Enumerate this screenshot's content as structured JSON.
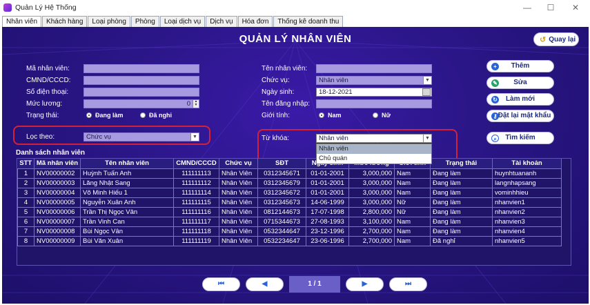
{
  "window": {
    "title": "Quản Lý Hệ Thống",
    "minimize": "—",
    "maximize": "☐",
    "close": "✕"
  },
  "tabs": [
    "Nhân viên",
    "Khách hàng",
    "Loại phòng",
    "Phòng",
    "Loại dịch vụ",
    "Dịch vụ",
    "Hóa đơn",
    "Thống kê doanh thu"
  ],
  "page": {
    "title": "QUẢN LÝ NHÂN VIÊN",
    "back_label": "Quay lại",
    "back_icon": "↺"
  },
  "form": {
    "ma_nhan_vien_label": "Mã nhân viên:",
    "cmnd_label": "CMND/CCCD:",
    "sdt_label": "Số điện thoại:",
    "muc_luong_label": "Mức lương:",
    "muc_luong_value": "0",
    "trang_thai_label": "Trạng thái:",
    "trang_thai_opt1": "Đang làm",
    "trang_thai_opt2": "Đã nghỉ",
    "ten_nv_label": "Tên nhân viên:",
    "chuc_vu_label": "Chức vụ:",
    "chuc_vu_value": "Nhân viên",
    "ngay_sinh_label": "Ngày sinh:",
    "ngay_sinh_value": "18-12-2021",
    "ten_dang_nhap_label": "Tên đăng nhập:",
    "gioi_tinh_label": "Giới tính:",
    "gioi_tinh_opt1": "Nam",
    "gioi_tinh_opt2": "Nữ"
  },
  "filter": {
    "loc_theo_label": "Lọc theo:",
    "loc_theo_value": "Chức vụ",
    "tu_khoa_label": "Từ khóa:",
    "tu_khoa_value": "Nhân viên",
    "options": [
      "Nhân viên",
      "Chủ quán"
    ]
  },
  "actions": {
    "them": "Thêm",
    "sua": "Sửa",
    "lam_moi": "Làm mới",
    "dat_lai_mk": "Đặt lại mật khẩu",
    "tim_kiem": "Tìm kiếm"
  },
  "table": {
    "title": "Danh sách nhân viên",
    "columns": [
      "STT",
      "Mã nhân viên",
      "Tên nhân viên",
      "CMND/CCCD",
      "Chức vụ",
      "SĐT",
      "Ngày sinh",
      "Mức lương",
      "Giới tính",
      "Trạng thái",
      "Tài khoản"
    ],
    "rows": [
      [
        "1",
        "NV00000002",
        "Huỳnh Tuấn Anh",
        "111111113",
        "Nhân Viên",
        "0312345671",
        "01-01-2001",
        "3,000,000",
        "Nam",
        "Đang làm",
        "huynhtuananh"
      ],
      [
        "2",
        "NV00000003",
        "Lăng Nhật Sang",
        "111111112",
        "Nhân Viên",
        "0312345679",
        "01-01-2001",
        "3,000,000",
        "Nam",
        "Đang làm",
        "langnhapsang"
      ],
      [
        "3",
        "NV00000004",
        "Võ Minh Hiếu 1",
        "111111114",
        "Nhân Viên",
        "0312345672",
        "01-01-2001",
        "3,000,000",
        "Nam",
        "Đang làm",
        "vominhhieu"
      ],
      [
        "4",
        "NV00000005",
        "Nguyễn Xuân Anh",
        "111111115",
        "Nhân Viên",
        "0312345673",
        "14-06-1999",
        "3,000,000",
        "Nữ",
        "Đang làm",
        "nhanvien1"
      ],
      [
        "5",
        "NV00000006",
        "Trần Thị Ngọc Vân",
        "111111116",
        "Nhân Viên",
        "0812144673",
        "17-07-1998",
        "2,800,000",
        "Nữ",
        "Đang làm",
        "nhanvien2"
      ],
      [
        "6",
        "NV00000007",
        "Trần Vinh Can",
        "111111117",
        "Nhân Viên",
        "0715344673",
        "27-08-1993",
        "3,100,000",
        "Nam",
        "Đang làm",
        "nhanvien3"
      ],
      [
        "7",
        "NV00000008",
        "Bùi Ngọc Vân",
        "111111118",
        "Nhân Viên",
        "0532344647",
        "23-12-1996",
        "2,700,000",
        "Nam",
        "Đang làm",
        "nhanvien4"
      ],
      [
        "8",
        "NV00000009",
        "Bùi Văn Xuân",
        "111111119",
        "Nhân Viên",
        "0532234647",
        "23-06-1996",
        "2,700,000",
        "Nam",
        "Đã nghỉ",
        "nhanvien5"
      ]
    ]
  },
  "pager": {
    "first": "⏮",
    "prev": "◀",
    "info": "1 / 1",
    "next": "▶",
    "last": "⏭"
  }
}
